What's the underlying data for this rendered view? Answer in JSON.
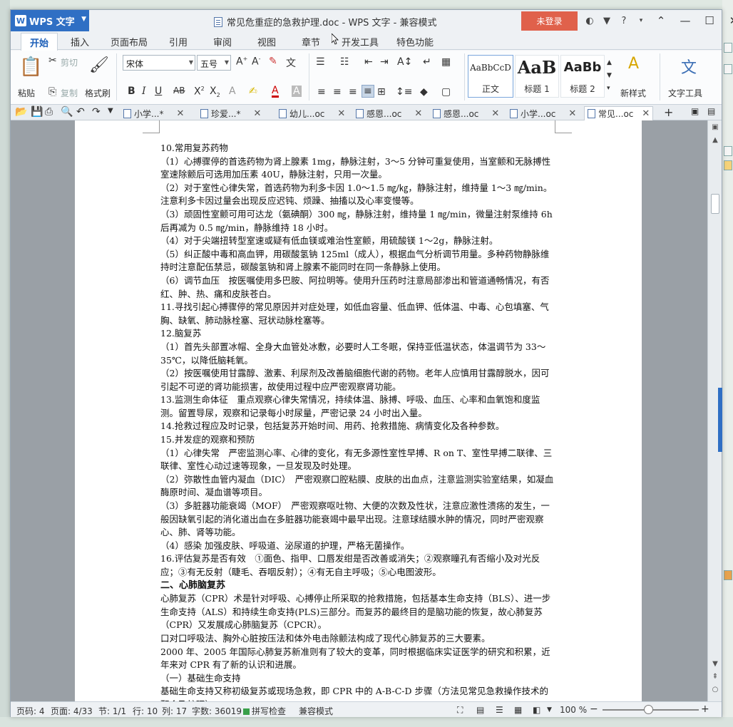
{
  "app": {
    "name": "WPS 文字",
    "logo_letter": "W",
    "window_title": "常见危重症的急救护理.doc - WPS 文字 - 兼容模式",
    "login_label": "未登录",
    "help_label": "?"
  },
  "tabs": [
    "开始",
    "插入",
    "页面布局",
    "引用",
    "审阅",
    "视图",
    "章节",
    "开发工具",
    "特色功能"
  ],
  "ribbon": {
    "paste": "粘贴",
    "cut": "剪切",
    "copy": "复制",
    "format_painter": "格式刷",
    "font_name": "宋体",
    "font_size": "五号",
    "styles": [
      {
        "sample": "AaBbCcD",
        "name": "正文"
      },
      {
        "sample": "AaB",
        "name": "标题 1"
      },
      {
        "sample": "AaBb",
        "name": "标题 2"
      }
    ],
    "new_style": "新样式",
    "text_tools": "文字工具"
  },
  "doc_tabs": [
    {
      "label": "小学...*"
    },
    {
      "label": "珍爱...*"
    },
    {
      "label": "幼儿...oc"
    },
    {
      "label": "感恩...oc"
    },
    {
      "label": "感恩...oc"
    },
    {
      "label": "小学...oc"
    },
    {
      "label": "常见...oc"
    }
  ],
  "document": {
    "paragraphs": [
      "10.常用复苏药物",
      "（1）心搏骤停的首选药物为肾上腺素 1mg，静脉注射，3～5 分钟可重复使用，当室颤和无脉搏性室速除颤后可选用加压素 40U，静脉注射，只用一次量。",
      "（2）对于室性心律失常，首选药物为利多卡因 1.0～1.5 ㎎/㎏，静脉注射，维持量 1～3 ㎎/min。注意利多卡因过量会出现反应迟钝、烦躁、抽搐以及心率变慢等。",
      "（3）顽固性室颤可用可达龙（氨碘酮）300 ㎎，静脉注射，维持量 1 ㎎/min，微量注射泵维持 6h 后再减为 0.5 ㎎/min，静脉维持 18 小时。",
      "（4）对于尖端扭转型室速或疑有低血镁或难治性室颤，用硫酸镁 1～2g，静脉注射。",
      "（5）纠正酸中毒和高血钾，用碳酸氢钠 125ml（成人），根据血气分析调节用量。多种药物静脉维持时注意配伍禁忌，碳酸氢钠和肾上腺素不能同时在同一条静脉上使用。",
      "（6）调节血压　按医嘱使用多巴胺、阿拉明等。使用升压药时注意局部渗出和管道通畅情况，有否红、肿、热、痛和皮肤苍白。",
      " 11.寻找引起心搏骤停的常见原因并对症处理，如低血容量、低血钾、低体温、中毒、心包填塞、气胸、缺氧、肺动脉栓塞、冠状动脉栓塞等。",
      " 12.脑复苏",
      "（1）首先头部置冰帽、全身大血管处冰敷，必要时人工冬眠，保持亚低温状态，体温调节为 33～35℃，以降低脑耗氧。",
      "（2）按医嘱使用甘露醇、激素、利尿剂及改善脑细胞代谢的药物。老年人应慎用甘露醇脱水，因可引起不可逆的肾功能损害，故使用过程中应严密观察肾功能。",
      "13.监测生命体征　重点观察心律失常情况，持续体温、脉搏、呼吸、血压、心率和血氧饱和度监测。留置导尿，观察和记录每小时尿量，严密记录 24 小时出入量。",
      "14.抢救过程应及时记录，包括复苏开始时间、用药、抢救措施、病情变化及各种参数。",
      "15.并发症的观察和预防",
      "（1）心律失常　严密监测心率、心律的变化，有无多源性室性早搏、R on T、室性早搏二联律、三联律、室性心动过速等现象，一旦发现及时处理。",
      "（2）弥散性血管内凝血（DIC）　严密观察口腔粘膜、皮肤的出血点，注意监测实验室结果，如凝血酶原时间、凝血谱等项目。",
      "（3）多脏器功能衰竭（MOF）　严密观察呕吐物、大便的次数及性状，注意应激性溃疡的发生，一般因缺氧引起的消化道出血在多脏器功能衰竭中最早出现。注意球结膜水肿的情况，同时严密观察心、肺、肾等功能。",
      "（4）感染 加强皮肤、呼吸道、泌尿道的护理，严格无菌操作。",
      "16.评估复苏是否有效　①面色、指甲、口唇发绀是否改善或消失；②观察瞳孔有否缩小及对光反应；③有无反射（睫毛、吞咽反射）；④有无自主呼吸；⑤心电图波形。",
      "二、心肺脑复苏",
      "心肺复苏（CPR）术是针对呼吸、心搏停止所采取的抢救措施，包括基本生命支持（BLS）、进一步生命支持（ALS）和持续生命支持(PLS)三部分。而复苏的最终目的是脑功能的恢复，故心肺复苏（CPR）又发展成心肺脑复苏（CPCR）。",
      "口对口呼吸法、胸外心脏按压法和体外电击除颤法构成了现代心肺复苏的三大要素。",
      "2000 年、2005 年国际心肺复苏新准则有了较大的变革，同时根据临床实证医学的研究和积累，近年来对 CPR 有了新的认识和进展。",
      "（一）基础生命支持",
      "基础生命支持又称初级复苏或现场急救，即 CPR 中的 A-B-C-D 步骤（方法见常见急救操作技术的配合及护理）。"
    ]
  },
  "status_bar": {
    "page_code": "页码: 4",
    "pages": "页面: 4/33",
    "section": "节: 1/1",
    "row": "行: 10",
    "column": "列: 17",
    "word_count": "字数: 36019",
    "spell_check": "拼写检查",
    "compat_mode": "兼容模式",
    "zoom": "100 %"
  }
}
